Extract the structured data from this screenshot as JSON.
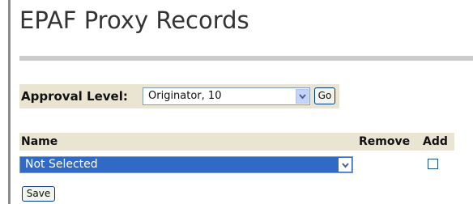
{
  "page": {
    "title": "EPAF Proxy Records"
  },
  "approval": {
    "label": "Approval Level:",
    "selected": "Originator, 10",
    "go_label": "Go"
  },
  "table": {
    "headers": {
      "name": "Name",
      "remove": "Remove",
      "add": "Add"
    },
    "row": {
      "name_selected": "Not Selected",
      "add_checked": false
    }
  },
  "actions": {
    "save_label": "Save"
  },
  "icons": {
    "dropdown": "chevron-down-icon"
  },
  "colors": {
    "band": "#eae4d2",
    "selection": "#316ac5",
    "title": "#333333"
  }
}
